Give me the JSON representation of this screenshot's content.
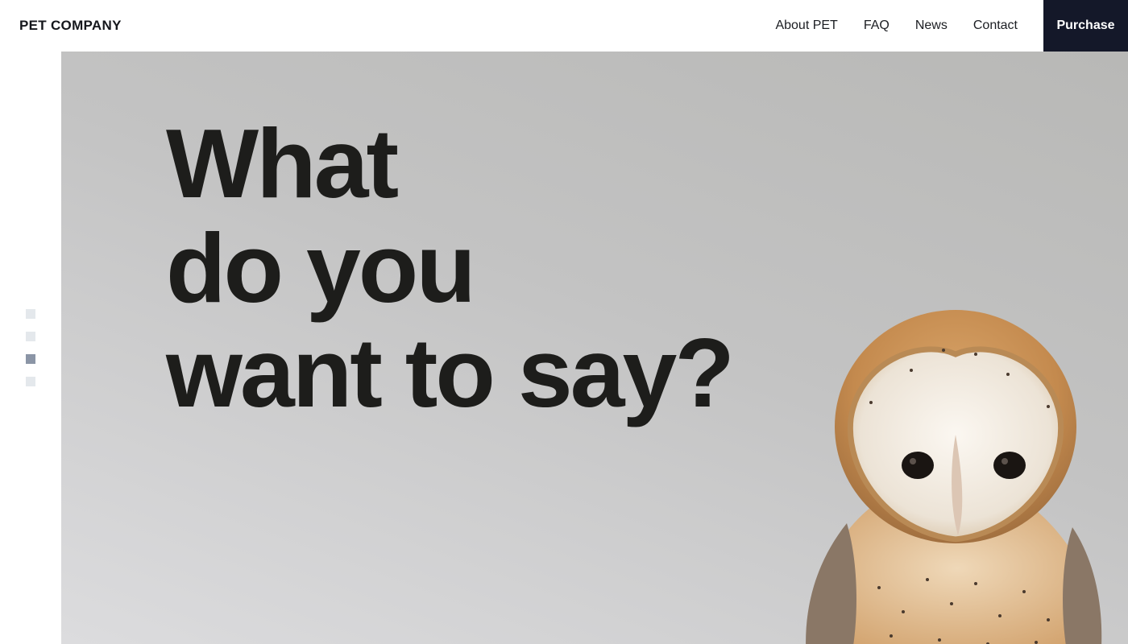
{
  "header": {
    "logo": "PET COMPANY",
    "nav": [
      "About PET",
      "FAQ",
      "News",
      "Contact"
    ],
    "purchase_label": "Purchase"
  },
  "hero": {
    "headline_lines": [
      "What",
      "do you",
      "want to say?"
    ],
    "slides": {
      "count": 4,
      "active_index": 2
    },
    "image": "barn-owl-photo"
  },
  "colors": {
    "accent": "#141829",
    "text": "#1d1d1b",
    "dot_inactive": "#e4e8ec",
    "dot_active": "#8b95a6"
  }
}
